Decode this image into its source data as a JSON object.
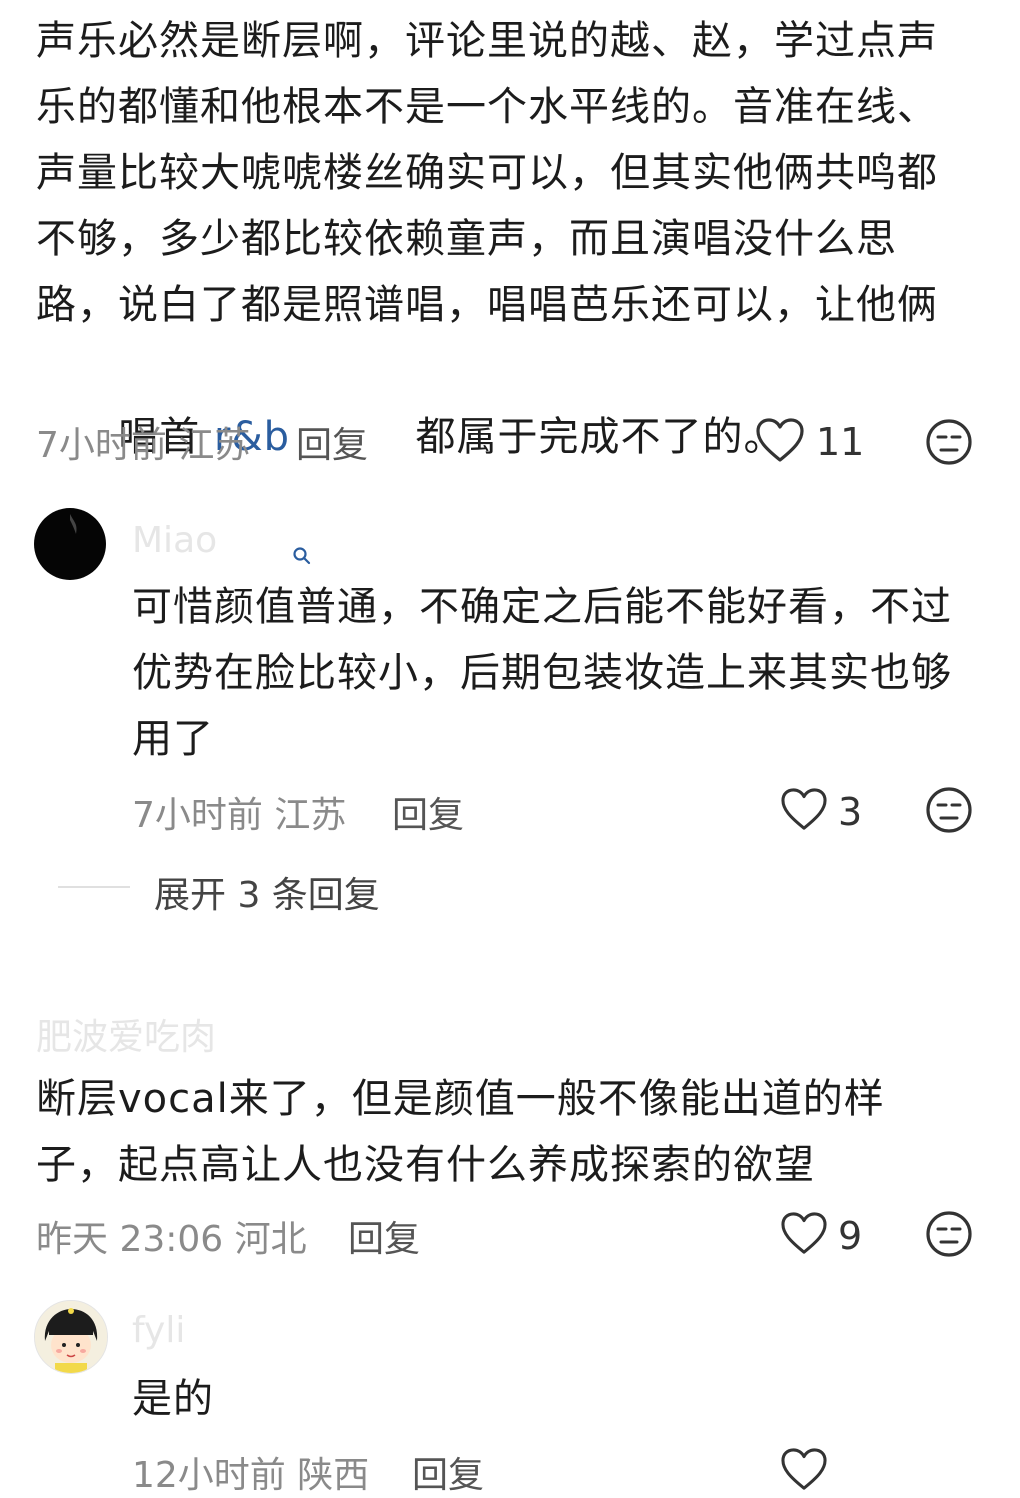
{
  "comment1": {
    "lines": [
      "声乐必然是断层啊，评论里说的越、赵，学过点声",
      "乐的都懂和他根本不是一个水平线的。音准在线、",
      "声量比较大唬唬楼丝确实可以，但其实他俩共鸣都",
      "不够，多少都比较依赖童声，而且演唱没什么思",
      "路，说白了都是照谱唱，唱唱芭乐还可以，让他俩"
    ],
    "last_prefix": "唱首 ",
    "link_text": "r&b",
    "last_suffix": " 都属于完成不了的。",
    "time": "7小时前",
    "location": "江苏",
    "reply_label": "回复",
    "likes": "11"
  },
  "reply1": {
    "username": "Miao",
    "lines": [
      "可惜颜值普通，不确定之后能不能好看，不过",
      "优势在脸比较小，后期包装妆造上来其实也够",
      "用了"
    ],
    "time": "7小时前",
    "location": "江苏",
    "reply_label": "回复",
    "likes": "3"
  },
  "expand_label": "展开 3 条回复",
  "comment2": {
    "username": "肥波爱吃肉",
    "lines": [
      "断层vocal来了，但是颜值一般不像能出道的样",
      "子，起点高让人也没有什么养成探索的欲望"
    ],
    "time": "昨天 23:06",
    "location": "河北",
    "reply_label": "回复",
    "likes": "9"
  },
  "reply2": {
    "username": "fyli",
    "lines": [
      "是的"
    ],
    "time": "12小时前",
    "location": "陕西",
    "reply_label": "回复",
    "likes": ""
  },
  "icons": {
    "like": "heart-outline-icon",
    "dislike": "meh-face-icon",
    "search": "search-link-icon"
  }
}
